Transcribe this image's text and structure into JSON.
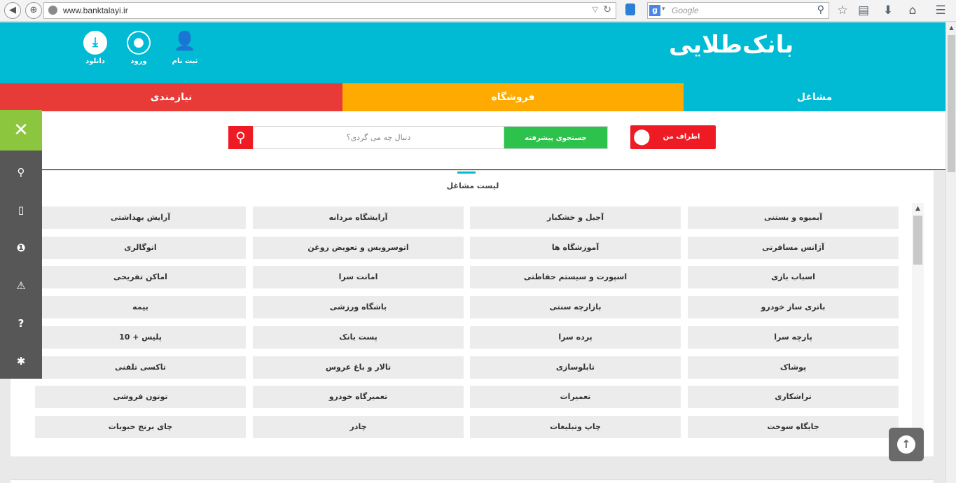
{
  "browser": {
    "url": "www.banktalayi.ir",
    "search_engine": "Google",
    "search_placeholder": "Google",
    "icons": [
      "back-arrow-icon",
      "site-identity-icon",
      "globe-icon",
      "reload-icon",
      "database-icon",
      "google-icon",
      "search-icon",
      "star-icon",
      "clipboard-icon",
      "download-arrow-icon",
      "home-icon",
      "menu-icon"
    ]
  },
  "site": {
    "logo": "بانک‌طلایی",
    "colors": {
      "header": "#01bbd4",
      "tab_mashaghel": "#01bbd4",
      "tab_forushgah": "#ffaa00",
      "tab_niazmandi": "#e83a37",
      "sidebar_close": "#8cc63e",
      "danger": "#ee1b24",
      "advanced": "#2cc24b"
    },
    "header_buttons": [
      {
        "label": "ثبت نام",
        "icon": "add-user-icon"
      },
      {
        "label": "ورود",
        "icon": "user-icon"
      },
      {
        "label": "دانلود",
        "icon": "download-icon"
      }
    ],
    "tabs": [
      {
        "label": "مشاغل",
        "active": true
      },
      {
        "label": "فروشگاه",
        "active": false
      },
      {
        "label": "نیازمندی",
        "active": false
      }
    ]
  },
  "search": {
    "near_me": "اطراف من",
    "advanced": "جستجوی پیشرفته",
    "placeholder": "دنبال چه می گردی؟"
  },
  "sidebar": {
    "items": [
      "close-icon",
      "location-pin-icon",
      "mobile-icon",
      "info-icon",
      "warning-icon",
      "help-icon",
      "asterisk-icon"
    ]
  },
  "list": {
    "title": "لیست مشاغل",
    "rows": [
      [
        "آبمیوه و بستنی",
        "آجیل و خشکبار",
        "آرایشگاه مردانه",
        "آرایش بهداشتی"
      ],
      [
        "آژانس مسافرتی",
        "آموزشگاه ها",
        "اتوسرویس و تعویض روغن",
        "اتوگالری"
      ],
      [
        "اسباب بازی",
        "اسپورت و سیستم حفاظتی",
        "امانت سرا",
        "اماکن تفریحی"
      ],
      [
        "باتری ساز خودرو",
        "بازارچه سنتی",
        "باشگاه ورزشی",
        "بیمه"
      ],
      [
        "پارچه سرا",
        "پرده سرا",
        "پست بانک",
        "پلیس + 10"
      ],
      [
        "پوشاک",
        "تابلوسازی",
        "تالار و باغ عروس",
        "تاکسی تلفنی"
      ],
      [
        "تراشکاری",
        "تعمیرات",
        "تعمیرگاه خودرو",
        "توتون فروشی"
      ],
      [
        "جایگاه سوخت",
        "چاپ وتبلیغات",
        "چادر",
        "چای برنج حبوبات"
      ]
    ]
  }
}
